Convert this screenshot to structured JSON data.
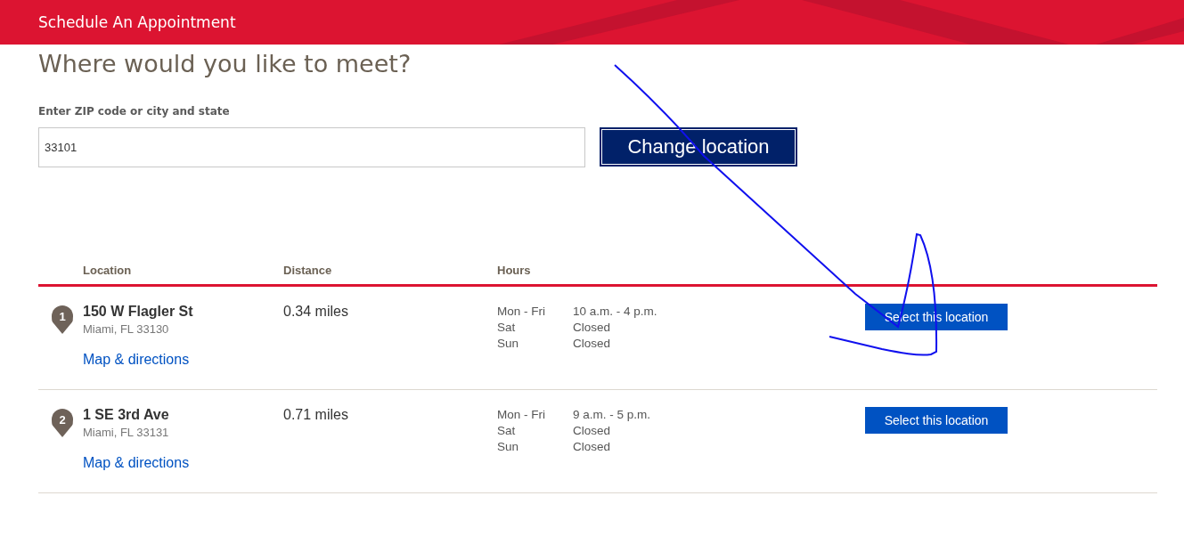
{
  "header": {
    "title": "Schedule An Appointment"
  },
  "heading": "Where would you like to meet?",
  "search": {
    "label": "Enter ZIP code or city and state",
    "value": "33101",
    "button": "Change location"
  },
  "table": {
    "columns": [
      "Location",
      "Distance",
      "Hours"
    ],
    "rows": [
      {
        "pin": "1",
        "name": "150 W Flagler St",
        "address": "Miami, FL 33130",
        "link": "Map & directions",
        "distance": "0.34 miles",
        "hours": [
          {
            "days": "Mon - Fri",
            "time": "10 a.m. - 4 p.m."
          },
          {
            "days": "Sat",
            "time": "Closed"
          },
          {
            "days": "Sun",
            "time": "Closed"
          }
        ],
        "button": "Select this location"
      },
      {
        "pin": "2",
        "name": "1 SE 3rd Ave",
        "address": "Miami, FL 33131",
        "link": "Map & directions",
        "distance": "0.71 miles",
        "hours": [
          {
            "days": "Mon - Fri",
            "time": "9 a.m. - 5 p.m."
          },
          {
            "days": "Sat",
            "time": "Closed"
          },
          {
            "days": "Sun",
            "time": "Closed"
          }
        ],
        "button": "Select this location"
      }
    ]
  }
}
